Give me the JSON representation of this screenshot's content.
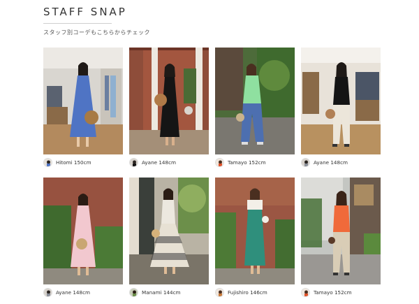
{
  "header": {
    "title": "STAFF SNAP",
    "subtitle": "スタッフ別コーデもこちらからチェック"
  },
  "snaps": [
    {
      "label": "Hitomi 150cm",
      "theme": "store-blue-dress"
    },
    {
      "label": "Ayane 148cm",
      "theme": "brick-black-dress"
    },
    {
      "label": "Tamayo 152cm",
      "theme": "garden-green-top"
    },
    {
      "label": "Ayane 148cm",
      "theme": "store-black-top"
    },
    {
      "label": "Ayane 148cm",
      "theme": "brick-pink-dress"
    },
    {
      "label": "Manami 144cm",
      "theme": "garden-print-skirt"
    },
    {
      "label": "Fujishiro 146cm",
      "theme": "brick-green-dress"
    },
    {
      "label": "Tamayo 152cm",
      "theme": "street-orange-top"
    }
  ],
  "colors": {
    "text": "#333333",
    "rule": "#cfcfcf"
  }
}
